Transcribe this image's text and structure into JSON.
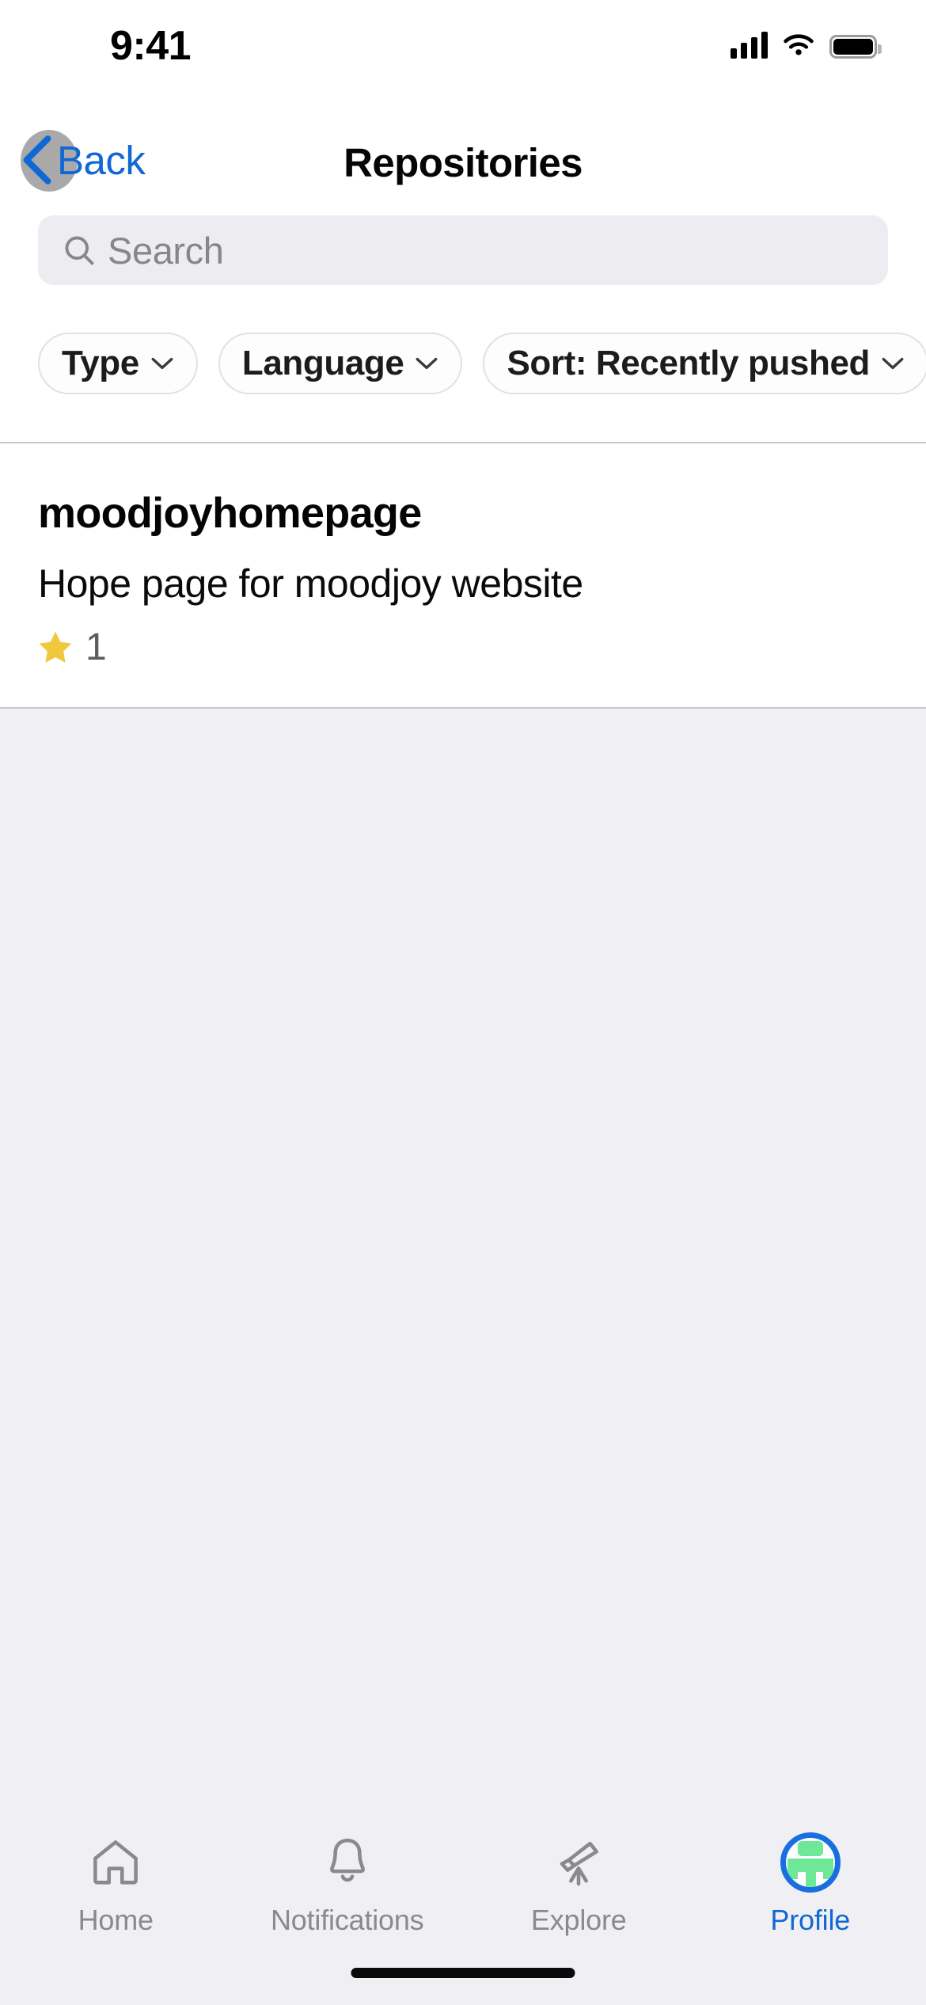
{
  "status_bar": {
    "time": "9:41",
    "icons": [
      "cellular-signal-icon",
      "wifi-icon",
      "battery-icon"
    ],
    "battery_full": true
  },
  "nav_bar": {
    "back_label": "Back",
    "back_icon": "chevron-left-icon",
    "title": "Repositories",
    "accent_color": "#1168D4"
  },
  "search": {
    "placeholder": "Search",
    "value": "",
    "icon": "search-icon",
    "background": "#EDECF0"
  },
  "filters": [
    {
      "label": "Type",
      "icon": "chevron-down-icon"
    },
    {
      "label": "Language",
      "icon": "chevron-down-icon"
    },
    {
      "label": "Sort: Recently pushed",
      "icon": "chevron-down-icon"
    }
  ],
  "repositories": [
    {
      "name": "moodjoyhomepage",
      "description": "Hope page for moodjoy website",
      "star_icon": "star-icon",
      "star_color": "#EFC93B",
      "stars": "1"
    }
  ],
  "tab_bar": {
    "active": "Profile",
    "items": [
      {
        "label": "Home",
        "icon": "home-icon",
        "active": false
      },
      {
        "label": "Notifications",
        "icon": "bell-icon",
        "active": false
      },
      {
        "label": "Explore",
        "icon": "telescope-icon",
        "active": false
      },
      {
        "label": "Profile",
        "icon": "avatar-icon",
        "active": true
      }
    ],
    "inactive_color": "#8A8A8E",
    "active_color": "#1168D4",
    "background": "#F0EFF4"
  },
  "home_indicator": "home-indicator"
}
